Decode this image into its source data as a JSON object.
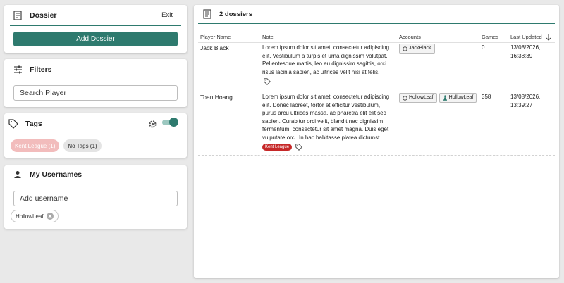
{
  "dossier_panel": {
    "title": "Dossier",
    "exit_label": "Exit",
    "add_label": "Add Dossier"
  },
  "filters_panel": {
    "title": "Filters",
    "search_placeholder": "Search Player"
  },
  "tags_panel": {
    "title": "Tags",
    "chips": [
      {
        "label": "Kent League (1)"
      },
      {
        "label": "No Tags (1)"
      }
    ]
  },
  "usernames_panel": {
    "title": "My Usernames",
    "input_placeholder": "Add username",
    "chips": [
      {
        "label": "HollowLeaf"
      }
    ]
  },
  "main": {
    "header_title": "2 dossiers",
    "columns": {
      "player": "Player Name",
      "note": "Note",
      "accounts": "Accounts",
      "games": "Games",
      "updated": "Last Updated"
    },
    "rows": [
      {
        "player": "Jack Black",
        "note": "Lorem ipsum dolor sit amet, consectetur adipiscing elit. Vestibulum a turpis et urna dignissim volutpat. Pellentesque mattis, leo eu dignissim sagittis, orci risus lacinia sapien, ac ultrices velit nisi at felis.",
        "accounts": [
          {
            "label": "JackBlack",
            "icon": "stopwatch-icon"
          }
        ],
        "games": "0",
        "updated": "13/08/2026, 16:38:39",
        "tags": []
      },
      {
        "player": "Toan Hoang",
        "note": "Lorem ipsum dolor sit amet, consectetur adipiscing elit. Donec laoreet, tortor et efficitur vestibulum, purus arcu ultrices massa, ac pharetra elit elit sed sapien. Curabitur orci velit, blandit nec dignissim fermentum, consectetur sit amet magna. Duis eget vulputate orci. In hac habitasse platea dictumst.",
        "accounts": [
          {
            "label": "HollowLeaf",
            "icon": "stopwatch-icon"
          },
          {
            "label": "HollowLeaf",
            "icon": "chess-pawn-icon"
          }
        ],
        "games": "358",
        "updated": "13/08/2026, 13:39:27",
        "tags": [
          {
            "label": "Kent League"
          }
        ]
      }
    ]
  },
  "colors": {
    "accent": "#2e7a6e",
    "tag_red": "#c62828",
    "tag_pink": "#f2bcbc"
  }
}
